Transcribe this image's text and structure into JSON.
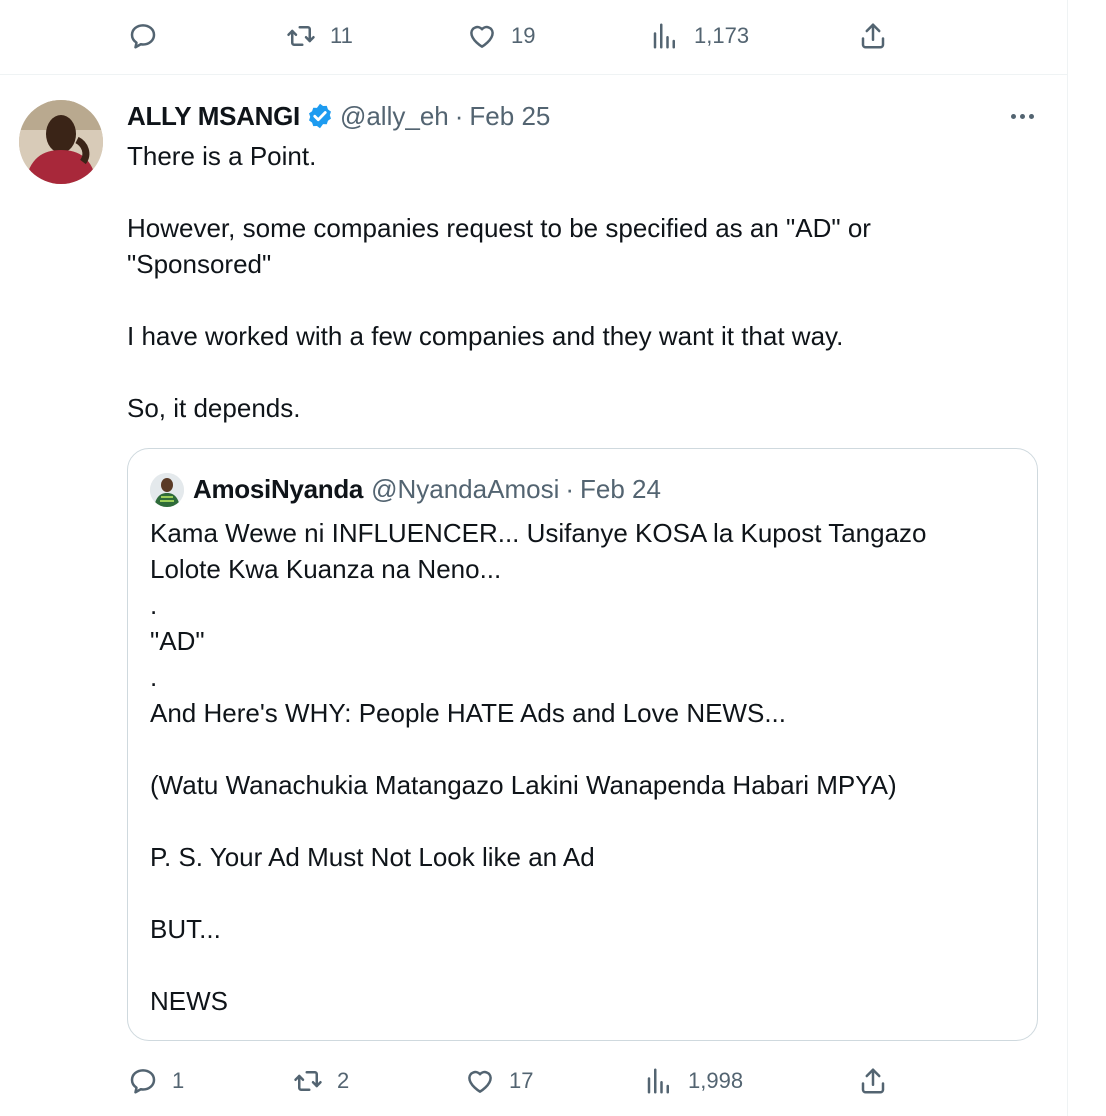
{
  "top_actions": {
    "reply_count": "",
    "retweet_count": "11",
    "like_count": "19",
    "view_count": "1,173"
  },
  "tweet": {
    "display_name": "ALLY MSANGI",
    "handle": "@ally_eh",
    "separator": "·",
    "date": "Feb 25",
    "verified": true,
    "text_lines": [
      "There is a Point.",
      "",
      "However, some companies request to be specified as an \"AD\" or",
      "\"Sponsored\"",
      "",
      "I have worked with a few companies and they want it that way.",
      "",
      "So, it depends."
    ],
    "quote": {
      "display_name": "AmosiNyanda",
      "handle": "@NyandaAmosi",
      "separator": "·",
      "date": "Feb 24",
      "text_lines": [
        "Kama Wewe ni INFLUENCER... Usifanye KOSA la Kupost Tangazo",
        "Lolote Kwa Kuanza na Neno...",
        ".",
        "\"AD\"",
        ".",
        "And Here's WHY: People HATE Ads and Love NEWS...",
        "",
        "(Watu Wanachukia Matangazo Lakini Wanapenda Habari MPYA)",
        "",
        "P. S. Your Ad Must Not Look like an Ad",
        "",
        "BUT...",
        "",
        "NEWS"
      ]
    },
    "actions": {
      "reply_count": "1",
      "retweet_count": "2",
      "like_count": "17",
      "view_count": "1,998"
    }
  },
  "colors": {
    "text_primary": "#0f1419",
    "text_secondary": "#536471",
    "verified_blue": "#1d9bf0",
    "border": "#cfd9de"
  },
  "icons": [
    "reply-icon",
    "retweet-icon",
    "like-icon",
    "views-icon",
    "share-icon",
    "verified-badge-icon",
    "more-icon"
  ]
}
